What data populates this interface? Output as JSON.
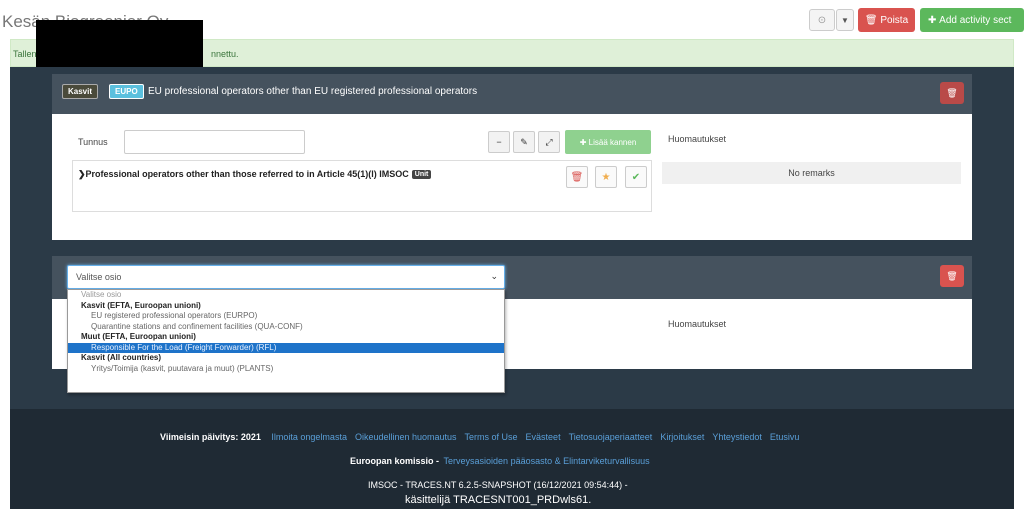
{
  "header": {
    "title": "Kesän Biogreenier Oy",
    "help_icon": "question-icon",
    "delete_label": "Poista",
    "add_label": "Add activity sect"
  },
  "alert": {
    "text_left": "Tallennettu",
    "text_right": "nnettu."
  },
  "panel1": {
    "badge_kasvit": "Kasvit",
    "badge_eupo": "EUPO",
    "title": "EU professional operators other than EU registered professional operators",
    "tunnus_label": "Tunnus",
    "tunnus_value": "",
    "add_note_label": "Lisää kannen",
    "remarks_header": "Huomautukset",
    "item_text": "Professional operators other than those referred to in Article 45(1)(l) IMSOC",
    "item_badge": "Unit",
    "no_remarks": "No remarks"
  },
  "panel2": {
    "select_value": "Valitse osio",
    "remarks_header": "Huomautukset",
    "options": [
      {
        "label": "Valitse osio",
        "kind": "first"
      },
      {
        "label": "Kasvit (EFTA, Euroopan unioni)",
        "kind": "group"
      },
      {
        "label": "EU registered professional operators (EURPO)",
        "kind": "child"
      },
      {
        "label": "Quarantine stations and confinement facilities (QUA-CONF)",
        "kind": "child"
      },
      {
        "label": "Muut (EFTA, Euroopan unioni)",
        "kind": "group"
      },
      {
        "label": "Responsible For the Load (Freight Forwarder) (RFL)",
        "kind": "child",
        "selected": true
      },
      {
        "label": "Kasvit (All countries)",
        "kind": "group"
      },
      {
        "label": "Yritys/Toimija (kasvit, puutavara ja muut) (PLANTS)",
        "kind": "child"
      }
    ]
  },
  "footer": {
    "updated_label": "Viimeisin päivitys: 2021",
    "links": [
      "Ilmoita ongelmasta",
      "Oikeudellinen huomautus",
      "Terms of Use",
      "Evästeet",
      "Tietosuojaperiaatteet",
      "Kirjoitukset",
      "Yhteystiedot",
      "Etusivu"
    ],
    "commission_label": "Euroopan komissio -",
    "commission_link": "Terveysasioiden pääosasto & Elintarviketurvallisuus",
    "version": "IMSOC - TRACES.NT 6.2.5-SNAPSHOT (16/12/2021 09:54:44) -",
    "user": "käsittelijä TRACESNT001_PRDwls61."
  },
  "colors": {
    "dark_bg": "#2b3a47",
    "panel_head": "#45525e",
    "success": "#5cb85c",
    "danger": "#d9534f",
    "footer_bg": "#1f2a34"
  }
}
